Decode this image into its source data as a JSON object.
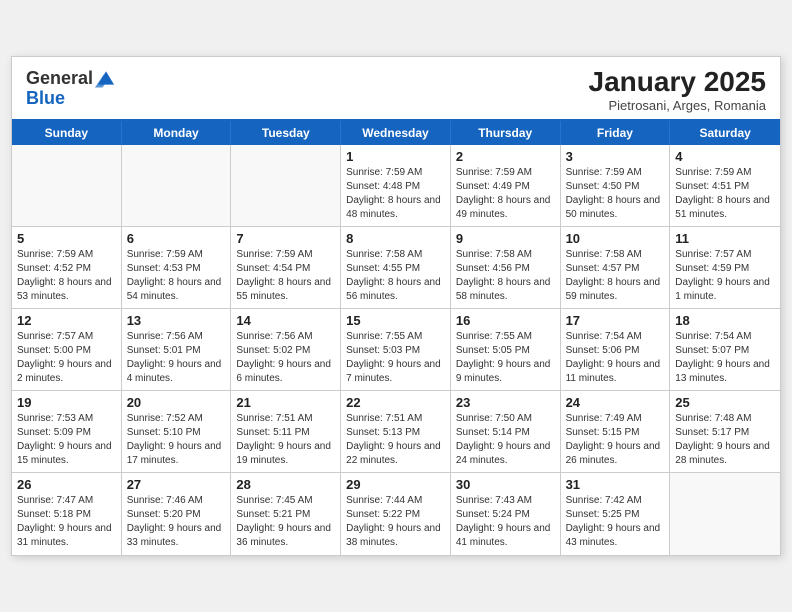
{
  "header": {
    "logo_general": "General",
    "logo_blue": "Blue",
    "month_title": "January 2025",
    "subtitle": "Pietrosani, Arges, Romania"
  },
  "day_headers": [
    "Sunday",
    "Monday",
    "Tuesday",
    "Wednesday",
    "Thursday",
    "Friday",
    "Saturday"
  ],
  "weeks": [
    [
      {
        "day": "",
        "empty": true
      },
      {
        "day": "",
        "empty": true
      },
      {
        "day": "",
        "empty": true
      },
      {
        "day": "1",
        "sunrise": "Sunrise: 7:59 AM",
        "sunset": "Sunset: 4:48 PM",
        "daylight": "Daylight: 8 hours and 48 minutes."
      },
      {
        "day": "2",
        "sunrise": "Sunrise: 7:59 AM",
        "sunset": "Sunset: 4:49 PM",
        "daylight": "Daylight: 8 hours and 49 minutes."
      },
      {
        "day": "3",
        "sunrise": "Sunrise: 7:59 AM",
        "sunset": "Sunset: 4:50 PM",
        "daylight": "Daylight: 8 hours and 50 minutes."
      },
      {
        "day": "4",
        "sunrise": "Sunrise: 7:59 AM",
        "sunset": "Sunset: 4:51 PM",
        "daylight": "Daylight: 8 hours and 51 minutes."
      }
    ],
    [
      {
        "day": "5",
        "sunrise": "Sunrise: 7:59 AM",
        "sunset": "Sunset: 4:52 PM",
        "daylight": "Daylight: 8 hours and 53 minutes."
      },
      {
        "day": "6",
        "sunrise": "Sunrise: 7:59 AM",
        "sunset": "Sunset: 4:53 PM",
        "daylight": "Daylight: 8 hours and 54 minutes."
      },
      {
        "day": "7",
        "sunrise": "Sunrise: 7:59 AM",
        "sunset": "Sunset: 4:54 PM",
        "daylight": "Daylight: 8 hours and 55 minutes."
      },
      {
        "day": "8",
        "sunrise": "Sunrise: 7:58 AM",
        "sunset": "Sunset: 4:55 PM",
        "daylight": "Daylight: 8 hours and 56 minutes."
      },
      {
        "day": "9",
        "sunrise": "Sunrise: 7:58 AM",
        "sunset": "Sunset: 4:56 PM",
        "daylight": "Daylight: 8 hours and 58 minutes."
      },
      {
        "day": "10",
        "sunrise": "Sunrise: 7:58 AM",
        "sunset": "Sunset: 4:57 PM",
        "daylight": "Daylight: 8 hours and 59 minutes."
      },
      {
        "day": "11",
        "sunrise": "Sunrise: 7:57 AM",
        "sunset": "Sunset: 4:59 PM",
        "daylight": "Daylight: 9 hours and 1 minute."
      }
    ],
    [
      {
        "day": "12",
        "sunrise": "Sunrise: 7:57 AM",
        "sunset": "Sunset: 5:00 PM",
        "daylight": "Daylight: 9 hours and 2 minutes."
      },
      {
        "day": "13",
        "sunrise": "Sunrise: 7:56 AM",
        "sunset": "Sunset: 5:01 PM",
        "daylight": "Daylight: 9 hours and 4 minutes."
      },
      {
        "day": "14",
        "sunrise": "Sunrise: 7:56 AM",
        "sunset": "Sunset: 5:02 PM",
        "daylight": "Daylight: 9 hours and 6 minutes."
      },
      {
        "day": "15",
        "sunrise": "Sunrise: 7:55 AM",
        "sunset": "Sunset: 5:03 PM",
        "daylight": "Daylight: 9 hours and 7 minutes."
      },
      {
        "day": "16",
        "sunrise": "Sunrise: 7:55 AM",
        "sunset": "Sunset: 5:05 PM",
        "daylight": "Daylight: 9 hours and 9 minutes."
      },
      {
        "day": "17",
        "sunrise": "Sunrise: 7:54 AM",
        "sunset": "Sunset: 5:06 PM",
        "daylight": "Daylight: 9 hours and 11 minutes."
      },
      {
        "day": "18",
        "sunrise": "Sunrise: 7:54 AM",
        "sunset": "Sunset: 5:07 PM",
        "daylight": "Daylight: 9 hours and 13 minutes."
      }
    ],
    [
      {
        "day": "19",
        "sunrise": "Sunrise: 7:53 AM",
        "sunset": "Sunset: 5:09 PM",
        "daylight": "Daylight: 9 hours and 15 minutes."
      },
      {
        "day": "20",
        "sunrise": "Sunrise: 7:52 AM",
        "sunset": "Sunset: 5:10 PM",
        "daylight": "Daylight: 9 hours and 17 minutes."
      },
      {
        "day": "21",
        "sunrise": "Sunrise: 7:51 AM",
        "sunset": "Sunset: 5:11 PM",
        "daylight": "Daylight: 9 hours and 19 minutes."
      },
      {
        "day": "22",
        "sunrise": "Sunrise: 7:51 AM",
        "sunset": "Sunset: 5:13 PM",
        "daylight": "Daylight: 9 hours and 22 minutes."
      },
      {
        "day": "23",
        "sunrise": "Sunrise: 7:50 AM",
        "sunset": "Sunset: 5:14 PM",
        "daylight": "Daylight: 9 hours and 24 minutes."
      },
      {
        "day": "24",
        "sunrise": "Sunrise: 7:49 AM",
        "sunset": "Sunset: 5:15 PM",
        "daylight": "Daylight: 9 hours and 26 minutes."
      },
      {
        "day": "25",
        "sunrise": "Sunrise: 7:48 AM",
        "sunset": "Sunset: 5:17 PM",
        "daylight": "Daylight: 9 hours and 28 minutes."
      }
    ],
    [
      {
        "day": "26",
        "sunrise": "Sunrise: 7:47 AM",
        "sunset": "Sunset: 5:18 PM",
        "daylight": "Daylight: 9 hours and 31 minutes."
      },
      {
        "day": "27",
        "sunrise": "Sunrise: 7:46 AM",
        "sunset": "Sunset: 5:20 PM",
        "daylight": "Daylight: 9 hours and 33 minutes."
      },
      {
        "day": "28",
        "sunrise": "Sunrise: 7:45 AM",
        "sunset": "Sunset: 5:21 PM",
        "daylight": "Daylight: 9 hours and 36 minutes."
      },
      {
        "day": "29",
        "sunrise": "Sunrise: 7:44 AM",
        "sunset": "Sunset: 5:22 PM",
        "daylight": "Daylight: 9 hours and 38 minutes."
      },
      {
        "day": "30",
        "sunrise": "Sunrise: 7:43 AM",
        "sunset": "Sunset: 5:24 PM",
        "daylight": "Daylight: 9 hours and 41 minutes."
      },
      {
        "day": "31",
        "sunrise": "Sunrise: 7:42 AM",
        "sunset": "Sunset: 5:25 PM",
        "daylight": "Daylight: 9 hours and 43 minutes."
      },
      {
        "day": "",
        "empty": true
      }
    ]
  ]
}
